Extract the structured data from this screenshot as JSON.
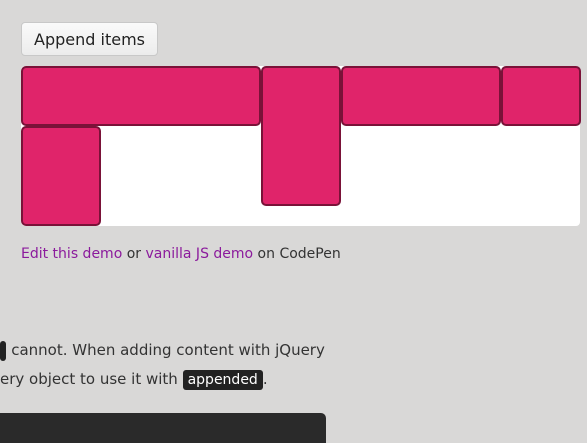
{
  "toolbar": {
    "append_label": "Append items"
  },
  "grid": {
    "item_color": "#e0246a",
    "item_border": "#7a1238",
    "background": "#ffffff"
  },
  "links": {
    "edit_demo": "Edit this demo",
    "or": " or ",
    "vanilla_demo": "vanilla JS demo",
    "on_codepen": " on CodePen"
  },
  "text": {
    "line1_tail": " cannot. When adding content with jQuery",
    "line2_head": "ery object to use it with ",
    "line2_code": "appended",
    "line2_tail": "."
  }
}
